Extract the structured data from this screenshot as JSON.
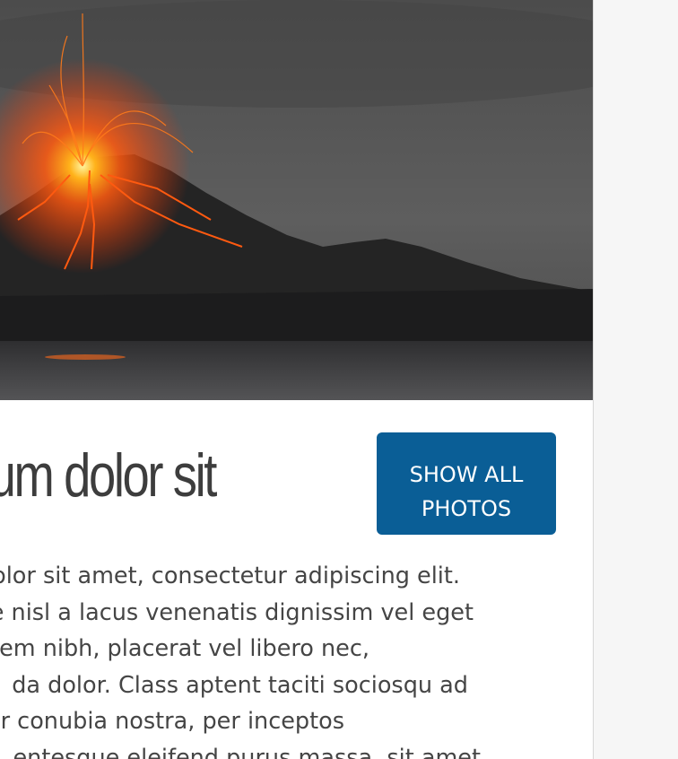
{
  "hero": {
    "image_alt": "Erupting volcano at night over a lake",
    "colors": {
      "sky": "#5a5a5a",
      "lava": "#ff6a1a",
      "mountain": "#222222",
      "water": "#3b3b3d"
    }
  },
  "article": {
    "title": "um dolor sit",
    "button": {
      "line1": "SHOW ALL",
      "line2": "PHOTOS",
      "color": "#0a5e96"
    },
    "paragraph_lines": [
      "olor sit amet, consectetur adipiscing elit.",
      "e nisl a lacus venenatis dignissim vel eget",
      " lorem nibh, placerat vel libero nec,",
      "da dolor. Class aptent taciti sociosqu ad",
      "per conubia nostra, per inceptos",
      "entesque eleifend purus massa, sit amet"
    ]
  }
}
